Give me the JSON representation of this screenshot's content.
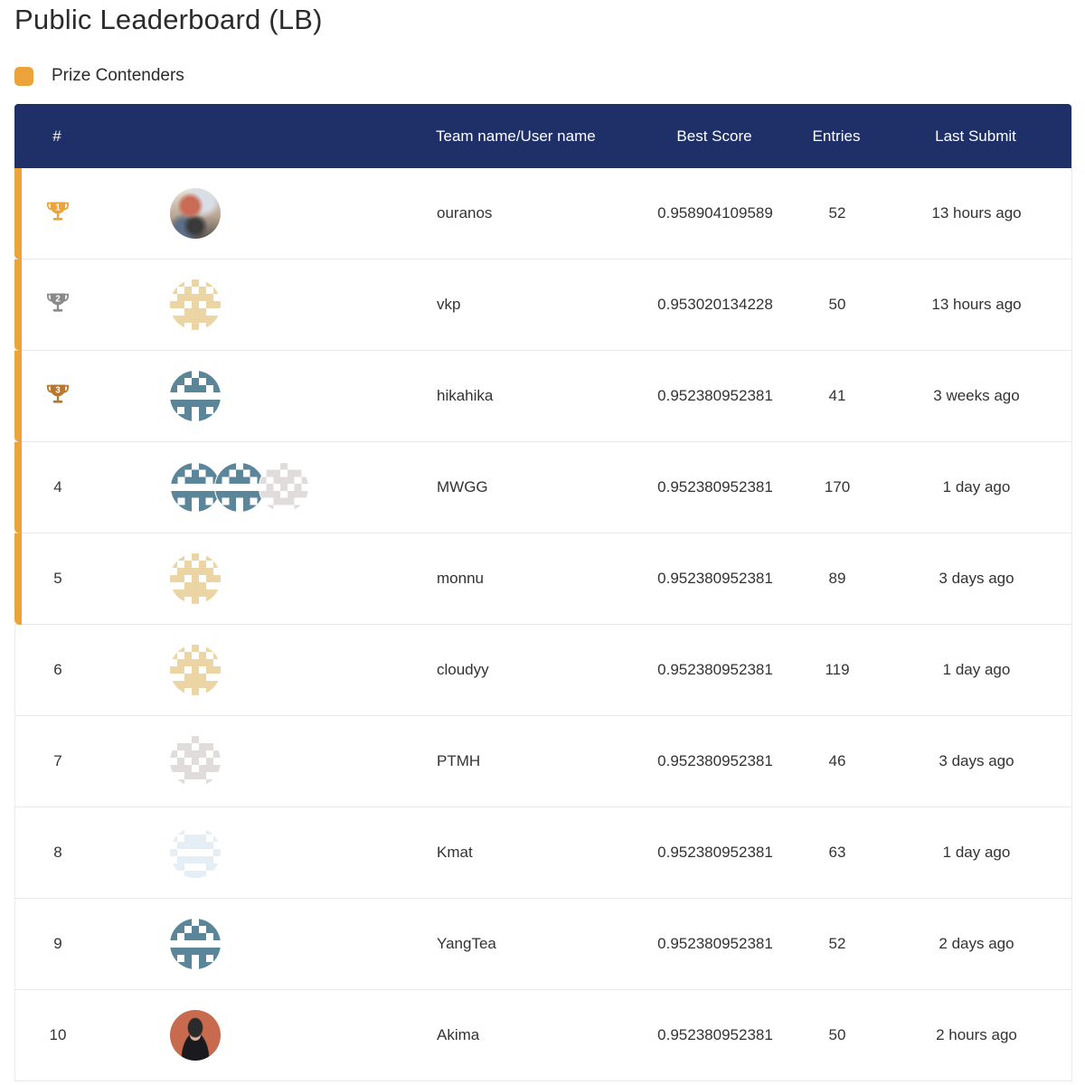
{
  "page": {
    "title": "Public Leaderboard (LB)",
    "legend": {
      "label": "Prize Contenders",
      "color": "#eba33a"
    }
  },
  "table": {
    "headers": {
      "rank": "#",
      "avatar": "",
      "name": "Team name/User name",
      "score": "Best Score",
      "entries": "Entries",
      "last_submit": "Last Submit"
    },
    "header_color": "#1f2f68",
    "rows": [
      {
        "rank": "1",
        "trophy": "gold",
        "prize": true,
        "avatars": [
          "photo-ouranos"
        ],
        "name": "ouranos",
        "score": "0.958904109589",
        "entries": "52",
        "last_submit": "13 hours ago"
      },
      {
        "rank": "2",
        "trophy": "silver",
        "prize": true,
        "avatars": [
          "identicon-tan"
        ],
        "name": "vkp",
        "score": "0.953020134228",
        "entries": "50",
        "last_submit": "13 hours ago"
      },
      {
        "rank": "3",
        "trophy": "bronze",
        "prize": true,
        "avatars": [
          "identicon-teal"
        ],
        "name": "hikahika",
        "score": "0.952380952381",
        "entries": "41",
        "last_submit": "3 weeks ago"
      },
      {
        "rank": "4",
        "trophy": null,
        "prize": true,
        "avatars": [
          "identicon-teal",
          "identicon-teal",
          "identicon-gray"
        ],
        "name": "MWGG",
        "score": "0.952380952381",
        "entries": "170",
        "last_submit": "1 day ago"
      },
      {
        "rank": "5",
        "trophy": null,
        "prize": true,
        "avatars": [
          "identicon-tan"
        ],
        "name": "monnu",
        "score": "0.952380952381",
        "entries": "89",
        "last_submit": "3 days ago"
      },
      {
        "rank": "6",
        "trophy": null,
        "prize": false,
        "avatars": [
          "identicon-tan"
        ],
        "name": "cloudyy",
        "score": "0.952380952381",
        "entries": "119",
        "last_submit": "1 day ago"
      },
      {
        "rank": "7",
        "trophy": null,
        "prize": false,
        "avatars": [
          "identicon-gray"
        ],
        "name": "PTMH",
        "score": "0.952380952381",
        "entries": "46",
        "last_submit": "3 days ago"
      },
      {
        "rank": "8",
        "trophy": null,
        "prize": false,
        "avatars": [
          "identicon-lightblue"
        ],
        "name": "Kmat",
        "score": "0.952380952381",
        "entries": "63",
        "last_submit": "1 day ago"
      },
      {
        "rank": "9",
        "trophy": null,
        "prize": false,
        "avatars": [
          "identicon-teal"
        ],
        "name": "YangTea",
        "score": "0.952380952381",
        "entries": "52",
        "last_submit": "2 days ago"
      },
      {
        "rank": "10",
        "trophy": null,
        "prize": false,
        "avatars": [
          "photo-akima"
        ],
        "name": "Akima",
        "score": "0.952380952381",
        "entries": "50",
        "last_submit": "2 hours ago"
      }
    ]
  },
  "colors": {
    "trophy_gold": "#eba33a",
    "trophy_silver": "#8a8a8a",
    "trophy_bronze": "#b8772c",
    "identicon-tan": "#ecd5a5",
    "identicon-teal": "#5b8599",
    "identicon-gray": "#e0dcdc",
    "identicon-lightblue": "#e6eef5"
  }
}
